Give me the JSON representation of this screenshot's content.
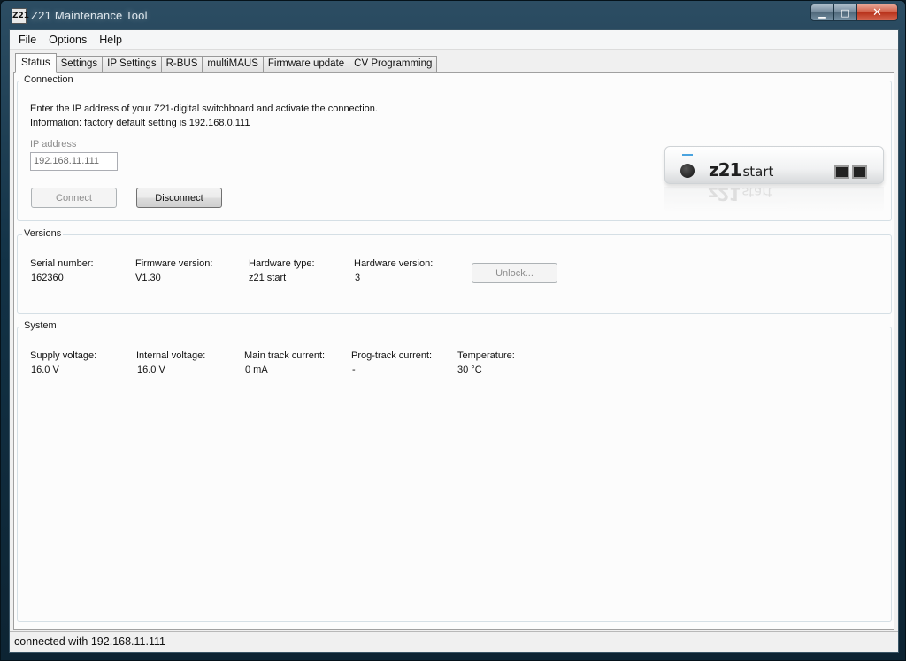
{
  "window": {
    "title": "Z21 Maintenance Tool",
    "icon_text": "Z21"
  },
  "menu": [
    "File",
    "Options",
    "Help"
  ],
  "tabs": [
    "Status",
    "Settings",
    "IP Settings",
    "R-BUS",
    "multiMAUS",
    "Firmware update",
    "CV Programming"
  ],
  "active_tab": "Status",
  "connection": {
    "label": "Connection",
    "line1": "Enter the IP address of your Z21-digital switchboard and activate the connection.",
    "line2": "Information: factory default setting is 192.168.0.111",
    "ip_label": "IP address",
    "ip_value": "192.168.11.111",
    "connect_label": "Connect",
    "disconnect_label": "Disconnect",
    "device_logo": "z21",
    "device_logo_suffix": "start"
  },
  "versions": {
    "label": "Versions",
    "columns": [
      {
        "label": "Serial number:",
        "value": "162360"
      },
      {
        "label": "Firmware version:",
        "value": "V1.30"
      },
      {
        "label": "Hardware type:",
        "value": "z21 start"
      },
      {
        "label": "Hardware version:",
        "value": "3"
      }
    ],
    "unlock_label": "Unlock..."
  },
  "system": {
    "label": "System",
    "columns": [
      {
        "label": "Supply voltage:",
        "value": "16.0 V"
      },
      {
        "label": "Internal voltage:",
        "value": "16.0 V"
      },
      {
        "label": "Main track current:",
        "value": "0 mA"
      },
      {
        "label": "Prog-track current:",
        "value": "-"
      },
      {
        "label": "Temperature:",
        "value": "30 °C"
      }
    ]
  },
  "statusbar": {
    "text": "connected with 192.168.11.111"
  },
  "colors": {
    "titlebar": "#123246",
    "close_button": "#c33a22",
    "panel": "#fcfcfc",
    "group_border": "#d5dfe5",
    "accent_led": "#4aa3df"
  }
}
